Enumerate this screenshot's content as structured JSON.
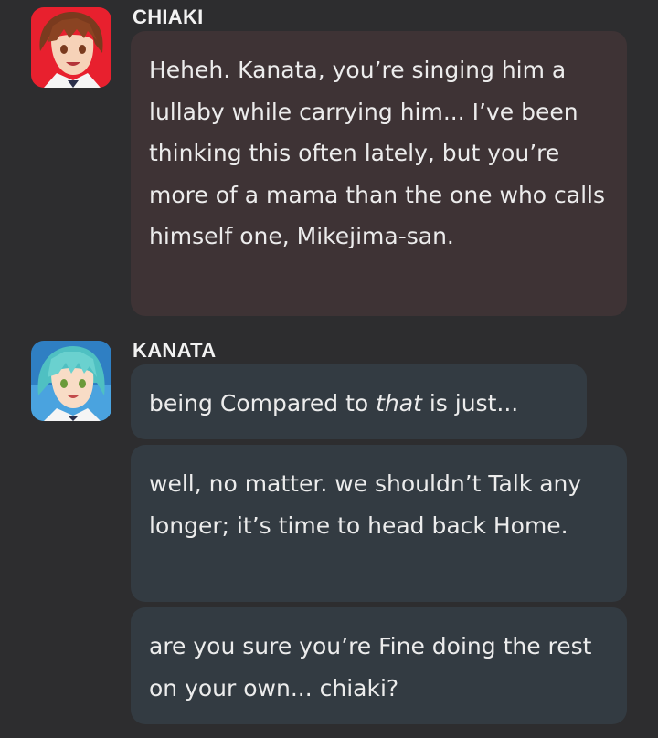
{
  "messages": [
    {
      "speaker": "CHIAKI",
      "avatar_icon": "chiaki-avatar-icon",
      "bubble_color": "#3e3335",
      "lines": [
        "Heheh. Kanata, you’re singing him a lullaby while carrying him... I’ve been thinking this often lately, but you’re more of a mama than the one who calls himself one, Mikejima-san."
      ]
    },
    {
      "speaker": "KANATA",
      "avatar_icon": "kanata-avatar-icon",
      "bubble_color": "#333b42",
      "lines": [
        {
          "before": "being Compared to ",
          "emphasis": "that",
          "after": " is just..."
        },
        "well, no matter. we shouldn’t Talk any longer; it’s time to head back Home.",
        "are you sure you’re Fine doing the rest on your own... chiaki?"
      ]
    }
  ],
  "colors": {
    "background": "#2d2d2f",
    "text": "#ececec",
    "name": "#f2f2f2"
  }
}
